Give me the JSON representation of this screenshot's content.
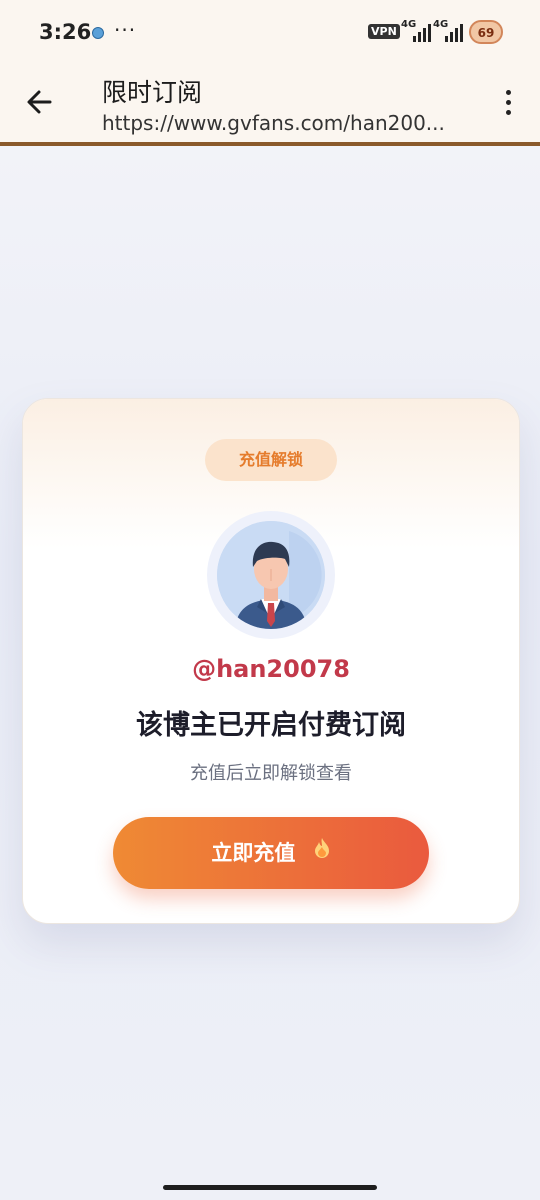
{
  "status_bar": {
    "time": "3:26",
    "more": "···",
    "vpn": "VPN",
    "network1": "4G",
    "network2": "4G",
    "battery": "69"
  },
  "toolbar": {
    "title": "限时订阅",
    "url": "https://www.gvfans.com/han200..."
  },
  "card": {
    "badge": "充值解锁",
    "username": "@han20078",
    "headline": "该博主已开启付费订阅",
    "subline": "充值后立即解锁查看",
    "cta_label": "立即充值",
    "cta_icon": "fire-icon"
  },
  "colors": {
    "accent_orange": "#ef8a34",
    "accent_red": "#ea5a3e",
    "username": "#c2394a",
    "toolbar_line": "#8a5a2b"
  }
}
